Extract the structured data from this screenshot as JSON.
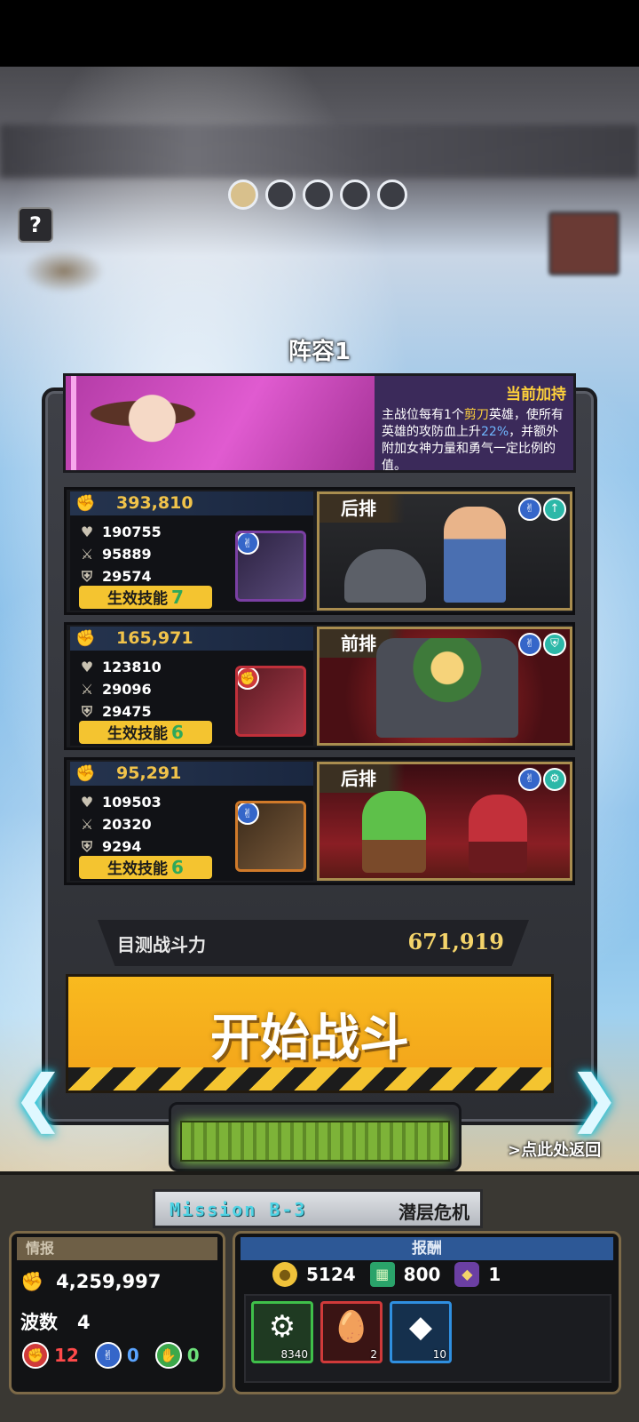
{
  "page": {
    "team_title": "阵容1",
    "page_dots": {
      "count": 5,
      "active_index": 0
    }
  },
  "banner": {
    "heading": "当前加持",
    "desc_part1": "主战位每有1个",
    "desc_highlight1": "剪刀",
    "desc_part2": "英雄，使所有英雄的攻防血上升",
    "desc_highlight2": "22%",
    "desc_part3": "，并额外附加女神力量和勇气一定比例的值。"
  },
  "teams": [
    {
      "power": "393,810",
      "hp": "190755",
      "attack": "95889",
      "defense": "29574",
      "skills_label": "生效技能",
      "skills_count": "7",
      "position": "后排",
      "hero_badge_icon": "scissors-icon",
      "badges": [
        "scissors-icon",
        "sword-icon"
      ]
    },
    {
      "power": "165,971",
      "hp": "123810",
      "attack": "29096",
      "defense": "29475",
      "skills_label": "生效技能",
      "skills_count": "6",
      "position": "前排",
      "hero_badge_icon": "rock-icon",
      "badges": [
        "scissors-icon",
        "shield-icon"
      ]
    },
    {
      "power": "95,291",
      "hp": "109503",
      "attack": "20320",
      "defense": "9294",
      "skills_label": "生效技能",
      "skills_count": "6",
      "position": "后排",
      "hero_badge_icon": "scissors-icon",
      "badges": [
        "scissors-icon",
        "gear-icon"
      ]
    }
  ],
  "combat": {
    "label": "目测战斗力",
    "value": "671,919"
  },
  "start_button": "开始战斗",
  "return_link": ">点此处返回",
  "mission": {
    "code": "Mission  B-3",
    "name": "潜层危机"
  },
  "intel": {
    "heading": "情报",
    "power": "4,259,997",
    "waves_label": "波数",
    "waves": "4",
    "rock_count": "12",
    "scissors_count": "0",
    "paper_count": "0"
  },
  "reward": {
    "heading": "报酬",
    "gold": "5124",
    "ticket": "800",
    "purple": "1",
    "items": [
      {
        "icon": "gear-emblem-icon",
        "qty": "8340",
        "rarity": "green"
      },
      {
        "icon": "egg-icon",
        "qty": "2",
        "rarity": "red"
      },
      {
        "icon": "crystal-icon",
        "qty": "10",
        "rarity": "blue"
      }
    ]
  },
  "colors": {
    "accent_yellow": "#f4c430",
    "power_gold": "#f1c34a",
    "scissors_blue": "#3566c9",
    "rock_red": "#d03a3a",
    "paper_green": "#3ba84a",
    "mission_cyan": "#4fd3e4"
  }
}
